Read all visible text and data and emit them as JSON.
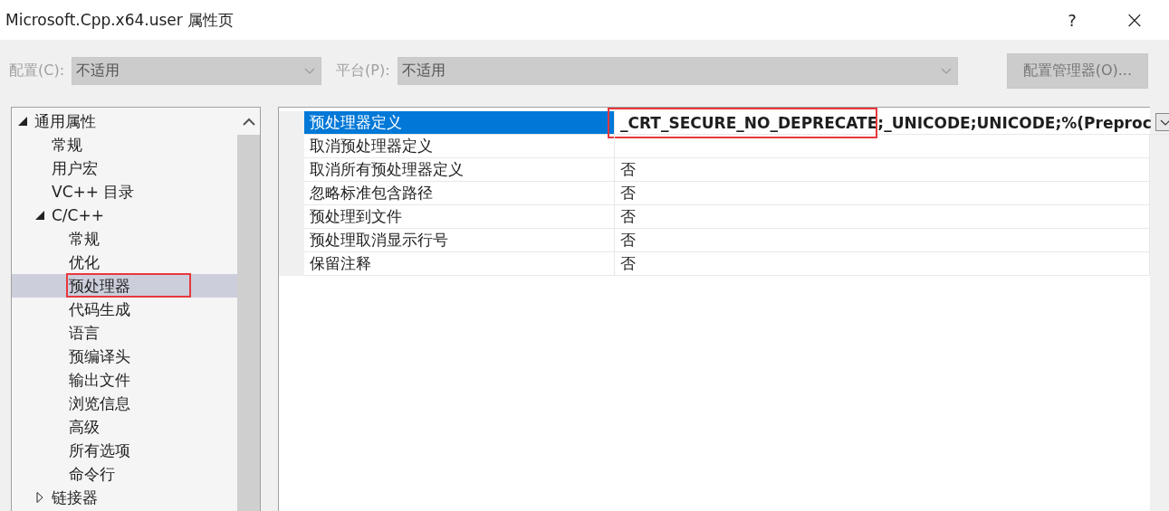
{
  "window": {
    "title": "Microsoft.Cpp.x64.user 属性页",
    "help": "?",
    "close": "×"
  },
  "toolbar": {
    "configuration": {
      "label": "配置(C):",
      "value": "不适用",
      "disabled": true
    },
    "platform": {
      "label": "平台(P):",
      "value": "不适用",
      "disabled": true
    },
    "manager_button": {
      "label": "配置管理器(O)...",
      "disabled": true
    }
  },
  "tree": [
    {
      "label": "通用属性",
      "expanded": true,
      "selected": false,
      "marked": false,
      "children": [
        {
          "label": "常规",
          "selected": false,
          "marked": false
        },
        {
          "label": "用户宏",
          "selected": false,
          "marked": false
        },
        {
          "label": "VC++ 目录",
          "selected": false,
          "marked": false
        },
        {
          "label": "C/C++",
          "expanded": true,
          "selected": false,
          "marked": false,
          "children": [
            {
              "label": "常规",
              "selected": false,
              "marked": false
            },
            {
              "label": "优化",
              "selected": false,
              "marked": false
            },
            {
              "label": "预处理器",
              "selected": true,
              "marked": true
            },
            {
              "label": "代码生成",
              "selected": false,
              "marked": false
            },
            {
              "label": "语言",
              "selected": false,
              "marked": false
            },
            {
              "label": "预编译头",
              "selected": false,
              "marked": false
            },
            {
              "label": "输出文件",
              "selected": false,
              "marked": false
            },
            {
              "label": "浏览信息",
              "selected": false,
              "marked": false
            },
            {
              "label": "高级",
              "selected": false,
              "marked": false
            },
            {
              "label": "所有选项",
              "selected": false,
              "marked": false
            },
            {
              "label": "命令行",
              "selected": false,
              "marked": false
            }
          ]
        },
        {
          "label": "链接器",
          "expanded": false,
          "selected": false,
          "marked": false
        }
      ]
    }
  ],
  "grid": {
    "rows": [
      {
        "name": "预处理器定义",
        "value": "_CRT_SECURE_NO_DEPRECATE;_UNICODE;UNICODE;%(Preproc",
        "selected": true,
        "marked": true
      },
      {
        "name": "取消预处理器定义",
        "value": "",
        "selected": false,
        "marked": false
      },
      {
        "name": "取消所有预处理器定义",
        "value": "否",
        "selected": false,
        "marked": false
      },
      {
        "name": "忽略标准包含路径",
        "value": "否",
        "selected": false,
        "marked": false
      },
      {
        "name": "预处理到文件",
        "value": "否",
        "selected": false,
        "marked": false
      },
      {
        "name": "预处理取消显示行号",
        "value": "否",
        "selected": false,
        "marked": false
      },
      {
        "name": "保留注释",
        "value": "否",
        "selected": false,
        "marked": false
      }
    ]
  }
}
